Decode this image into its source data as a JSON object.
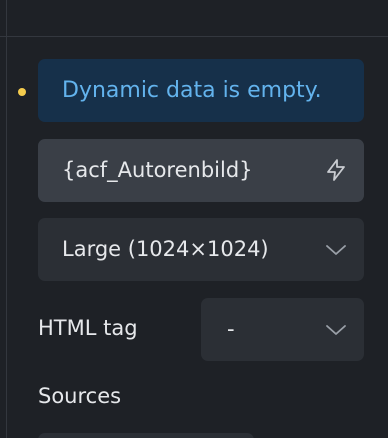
{
  "notice": {
    "text": "Dynamic data is empty.",
    "indicator_color": "#f5cc4d"
  },
  "dynamic_field": {
    "value": "{acf_Autorenbild}",
    "icon": "bolt-icon"
  },
  "size_select": {
    "selected": "Large (1024×1024)",
    "icon": "chevron-down-icon"
  },
  "html_tag": {
    "label": "HTML tag",
    "selected": "-",
    "icon": "chevron-down-icon"
  },
  "sources": {
    "label": "Sources"
  },
  "colors": {
    "background": "#1e2126",
    "notice_bg": "#16304a",
    "notice_text": "#63b3ed",
    "field_bg": "#3a3f47",
    "select_bg": "#2b2f35",
    "text": "#e6e8eb"
  }
}
